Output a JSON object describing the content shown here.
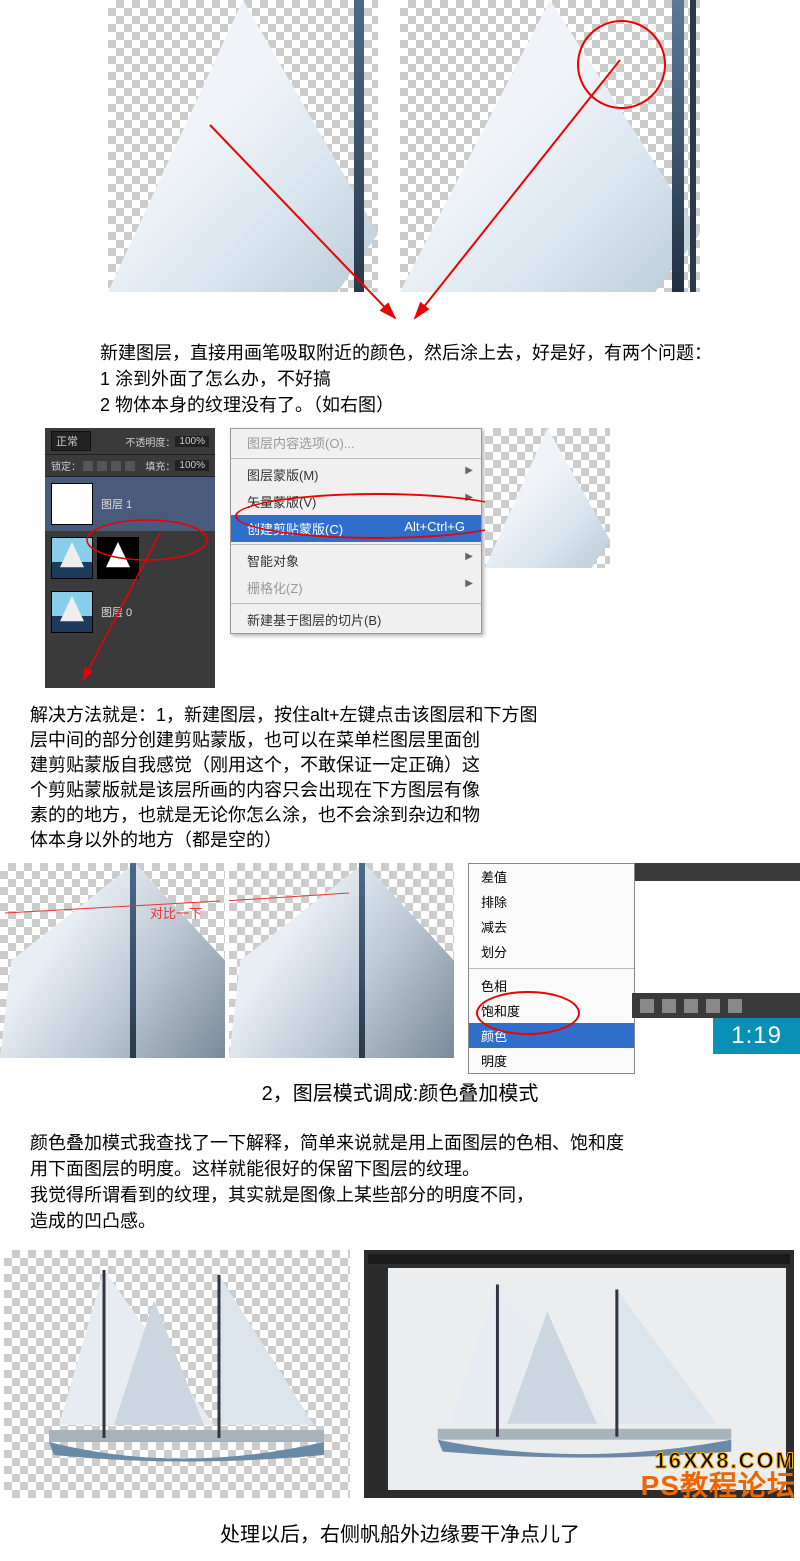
{
  "section1": {
    "text1": "新建图层，直接用画笔吸取附近的颜色，然后涂上去，好是好，有两个问题：",
    "text2": "1  涂到外面了怎么办，不好搞",
    "text3": "2  物体本身的纹理没有了。（如右图）"
  },
  "ps_panel": {
    "blend_mode": "正常",
    "opacity_label": "不透明度：",
    "opacity_value": "100%",
    "fill_label": "填充：",
    "fill_value": "100%",
    "lock_label": "锁定：",
    "layer1": "图层 1",
    "layer0": "图层 0"
  },
  "context_menu": {
    "item0": "图层内容选项(O)...",
    "item1": "图层蒙版(M)",
    "item2": "矢量蒙版(V)",
    "item3": "创建剪贴蒙版(C)",
    "shortcut3": "Alt+Ctrl+G",
    "item4": "智能对象",
    "item5": "栅格化(Z)",
    "item6": "新建基于图层的切片(B)"
  },
  "section2": {
    "line1": "解决方法就是：1，新建图层，按住alt+左键点击该图层和下方图",
    "line2": "层中间的部分创建剪贴蒙版，也可以在菜单栏图层里面创",
    "line3": "建剪贴蒙版自我感觉（刚用这个，不敢保证一定正确）这",
    "line4": "个剪贴蒙版就是该层所画的内容只会出现在下方图层有像",
    "line5": "素的的地方，也就是无论你怎么涂，也不会涂到杂边和物",
    "line6": "体本身以外的地方（都是空的）"
  },
  "compare_label": "对比一下",
  "blend_menu": {
    "title_cut": "差值",
    "items": [
      "差值",
      "排除",
      "减去",
      "划分"
    ],
    "items2": [
      "色相",
      "饱和度",
      "颜色",
      "明度"
    ]
  },
  "time": "1:19",
  "caption1": "2，图层模式调成:颜色叠加模式",
  "section3": {
    "line1": "颜色叠加模式我查找了一下解释，简单来说就是用上面图层的色相、饱和度",
    "line2": "用下面图层的明度。这样就能很好的保留下图层的纹理。",
    "line3": "我觉得所谓看到的纹理，其实就是图像上某些部分的明度不同，",
    "line4": "造成的凹凸感。"
  },
  "caption2": "处理以后，右侧帆船外边缘要干净点儿了",
  "watermark": {
    "top": "16XX8.COM",
    "bottom": "PS教程论坛"
  }
}
